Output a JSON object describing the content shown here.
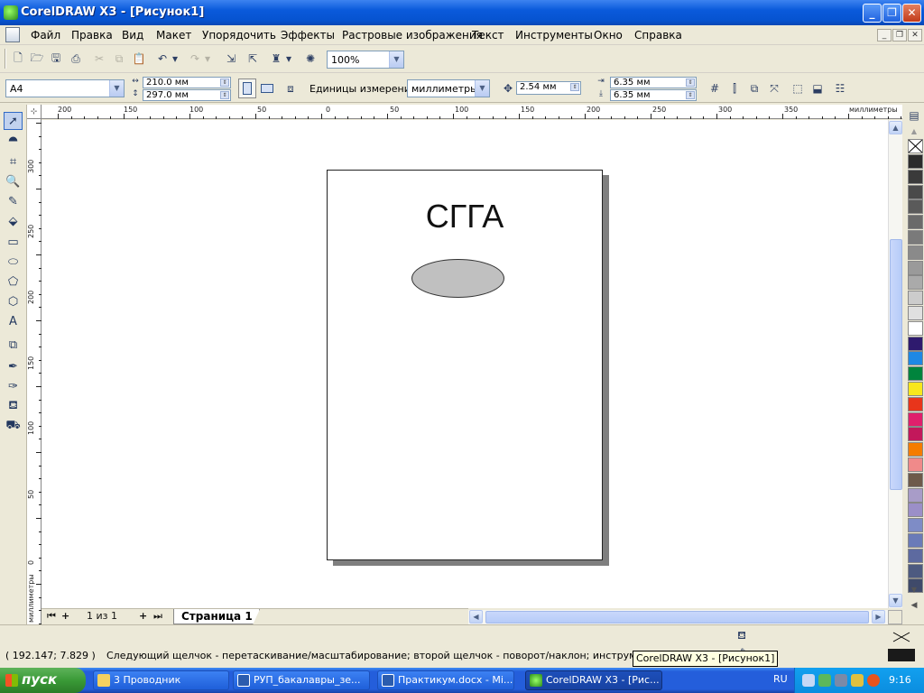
{
  "window": {
    "title": "CorelDRAW X3 - [Рисунок1]",
    "controls": {
      "minimize": "_",
      "maximize": "❐",
      "close": "✕"
    }
  },
  "menu": {
    "items": [
      "Файл",
      "Правка",
      "Вид",
      "Макет",
      "Упорядочить",
      "Эффекты",
      "Растровые изображения",
      "Текст",
      "Инструменты",
      "Окно",
      "Справка"
    ],
    "mdi": {
      "minimize": "_",
      "restore": "❐",
      "close": "✕"
    }
  },
  "toolbar": {
    "zoom": "100%"
  },
  "propertybar": {
    "paper_size": "A4",
    "width": "210.0 мм",
    "height": "297.0 мм",
    "units_label": "Единицы измерения:",
    "units_value": "миллиметры",
    "nudge": "2.54 мм",
    "dup_x": "6.35 мм",
    "dup_y": "6.35 мм"
  },
  "rulers": {
    "unit_label": "миллиметры",
    "h_labels": [
      "200",
      "150",
      "100",
      "50",
      "0",
      "50",
      "100",
      "150",
      "200",
      "250",
      "300",
      "350"
    ],
    "v_labels": [
      "300",
      "250",
      "200",
      "150",
      "100",
      "50",
      "0"
    ]
  },
  "document": {
    "title_text": "СГГА",
    "ellipse_fill": "#c0c0c0"
  },
  "pagenav": {
    "counter": "1 из 1",
    "tab": "Страница 1"
  },
  "palette": [
    "#2b2b2b",
    "#3a3a3a",
    "#4a4a4a",
    "#5a5a5a",
    "#6a6a6a",
    "#7a7a7a",
    "#8a8a8a",
    "#9a9a9a",
    "#aaaaaa",
    "#cccccc",
    "#e0e0e0",
    "#ffffff",
    "#2e1a6e",
    "#1e88e5",
    "#00843d",
    "#f8e71c",
    "#e8351b",
    "#e01f6c",
    "#c2185b",
    "#f57c00",
    "#f08a8a",
    "#6d5a4a",
    "#a89cc8",
    "#9b8fc8",
    "#7e8cc6",
    "#6a7bb8",
    "#5d6aa0",
    "#4d5a80",
    "#3f4a6a"
  ],
  "status": {
    "coords": "( 192.147; 7.829  )",
    "message": "Следующий щелчок - перетаскивание/масштабирование; второй щелчок - поворот/наклон; инструмент с двойны",
    "tooltip": "CorelDRAW X3 - [Рисунок1]"
  },
  "taskbar": {
    "start": "пуск",
    "tasks": [
      "3 Проводник",
      "РУП_бакалавры_зе...",
      "Практикум.docx - Mi...",
      "CorelDRAW X3 - [Рис..."
    ],
    "lang": "RU",
    "clock": "9:16"
  }
}
